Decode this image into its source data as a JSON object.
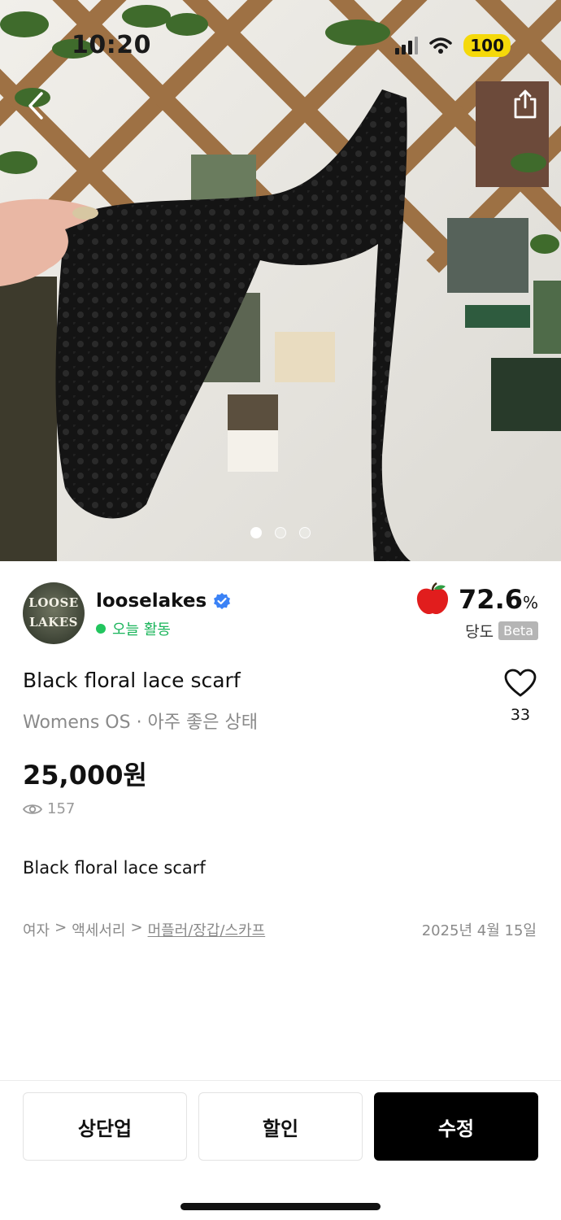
{
  "status_bar": {
    "time": "10:20",
    "battery": "100"
  },
  "hero": {
    "page_count": 3,
    "active_page": 1
  },
  "seller": {
    "avatar_text_line1": "LOOSE",
    "avatar_text_line2": "LAKES",
    "name": "looselakes",
    "verified": true,
    "activity": "오늘 활동",
    "trust_value": "72.6",
    "trust_unit": "%",
    "trust_label": "당도",
    "trust_badge": "Beta"
  },
  "product": {
    "title": "Black floral lace scarf",
    "subtitle": "Womens OS · 아주 좋은 상태",
    "price": "25,000원",
    "views": "157",
    "likes": "33",
    "description": "Black floral lace scarf",
    "breadcrumb": {
      "level1": "여자",
      "separator": ">",
      "level2": "액세서리",
      "level3": "머플러/장갑/스카프"
    },
    "date": "2025년 4월 15일"
  },
  "actions": {
    "bump_label": "상단업",
    "discount_label": "할인",
    "edit_label": "수정"
  },
  "colors": {
    "accent_green": "#22c55e",
    "battery_yellow": "#f5d90a",
    "verified_blue": "#3b82f6",
    "apple_red": "#e11d1d"
  },
  "icons": [
    "back-arrow-icon",
    "share-icon",
    "verified-check-icon",
    "apple-icon",
    "heart-icon",
    "eye-icon",
    "signal-icon",
    "wifi-icon"
  ]
}
